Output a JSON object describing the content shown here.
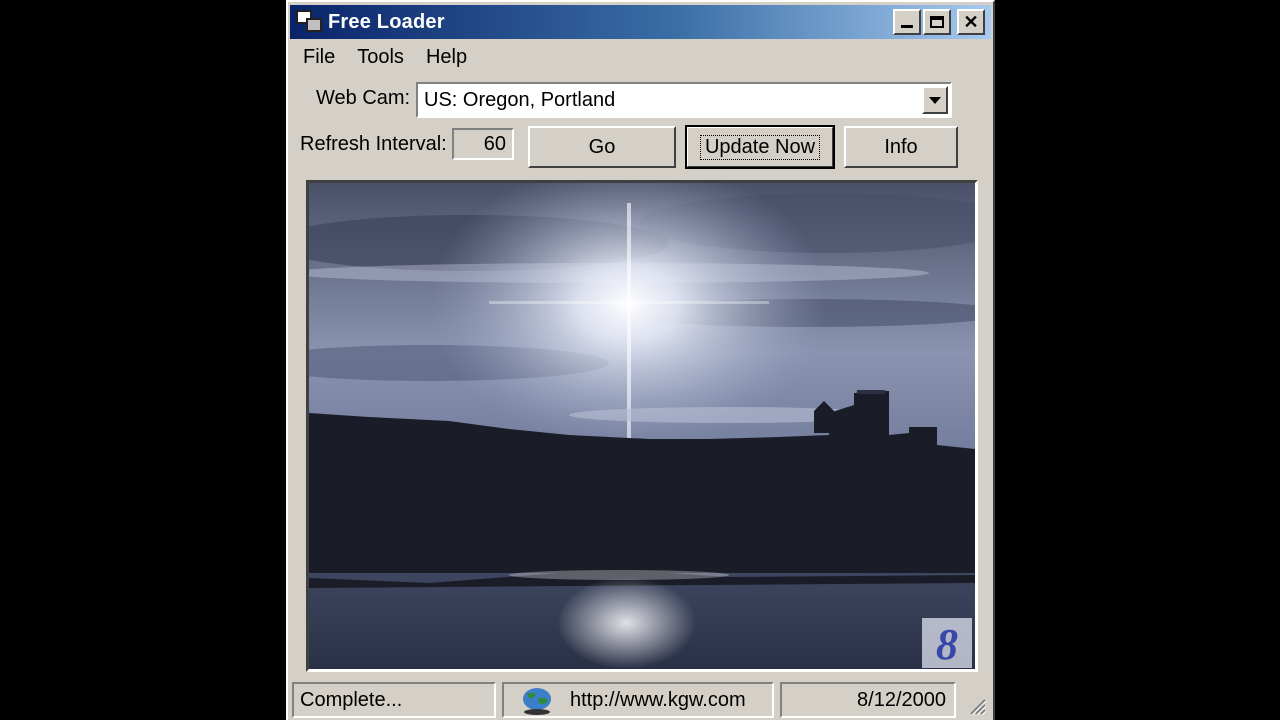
{
  "window": {
    "title": "Free Loader",
    "controls": {
      "minimize": "_",
      "maximize": "□",
      "close": "✕"
    }
  },
  "menu": [
    "File",
    "Tools",
    "Help"
  ],
  "webcam": {
    "label": "Web Cam:",
    "selected": "US: Oregon, Portland"
  },
  "refresh": {
    "label": "Refresh Interval:",
    "value": "60"
  },
  "buttons": {
    "go": "Go",
    "update": "Update Now",
    "info": "Info"
  },
  "viewer": {
    "station_logo": "8"
  },
  "status": {
    "state": "Complete...",
    "url": "http://www.kgw.com",
    "date": "8/12/2000"
  },
  "colors": {
    "title_start": "#0a246a",
    "title_end": "#a6caf0",
    "face": "#d4d0c8"
  },
  "icons": [
    "app-icon",
    "minimize-icon",
    "maximize-icon",
    "close-icon",
    "chevron-down-icon",
    "globe-icon",
    "resize-grip-icon"
  ]
}
